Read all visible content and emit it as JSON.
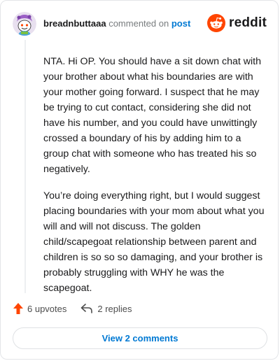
{
  "header": {
    "username": "breadnbuttaaa",
    "commented_on": "commented on",
    "post_link": "post",
    "logo_text": "reddit"
  },
  "comment": {
    "paragraphs": [
      "NTA. Hi OP. You should have a sit down chat with your brother about what his boundaries are with your mother going forward. I suspect that he may be trying to cut contact, considering she did not have his number, and you could have unwittingly crossed a boundary of his by adding him to a group chat with someone who has treated his so negatively.",
      "You’re doing everything right, but I would suggest placing boundaries with your mom about what you will and will not discuss. The golden child/scapegoat relationship between parent and children is so so so damaging, and your brother is probably struggling with WHY he was the scapegoat."
    ]
  },
  "actions": {
    "upvotes": "6 upvotes",
    "replies": "2 replies"
  },
  "footer": {
    "view_comments": "View 2 comments"
  },
  "colors": {
    "brand": "#ff4500",
    "link": "#0079d3",
    "upvote": "#ff4500"
  },
  "icons": {
    "avatar": "snoo-avatar",
    "logo": "reddit-snoo-icon",
    "upvote": "upvote-arrow-icon",
    "reply": "reply-arrow-icon"
  }
}
